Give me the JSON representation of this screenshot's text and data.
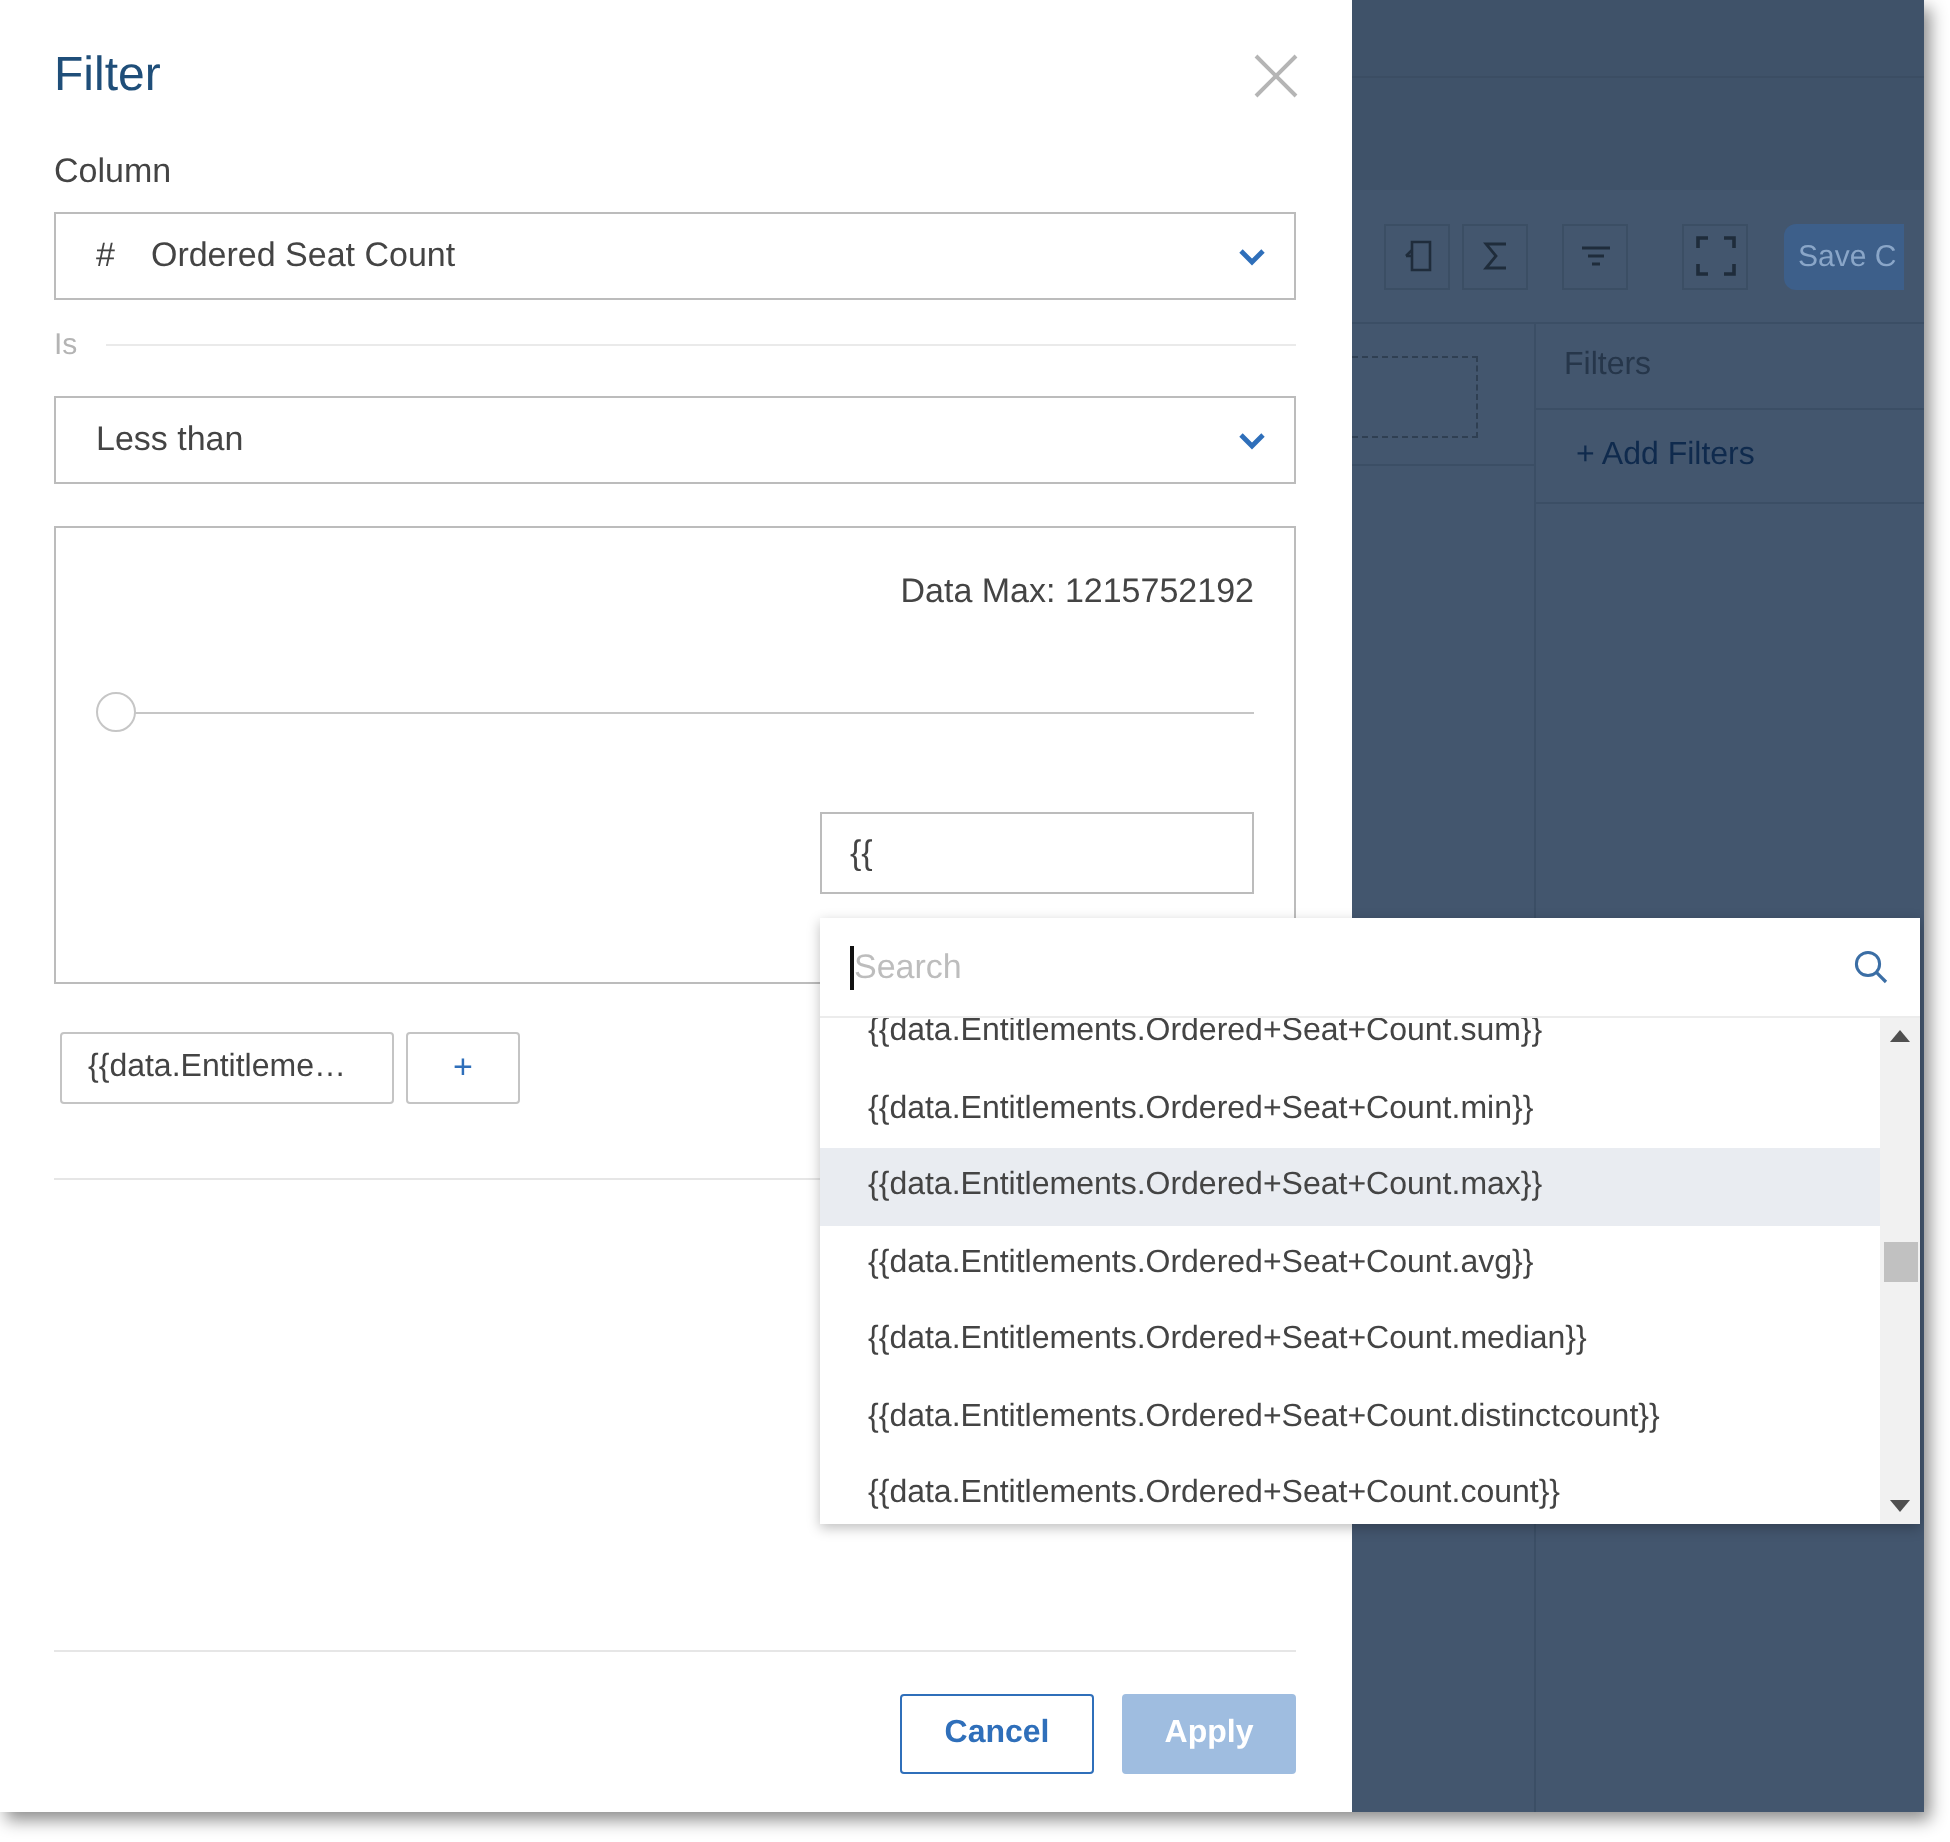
{
  "dialog": {
    "title": "Filter",
    "column_label": "Column",
    "column_select": {
      "type_icon": "#",
      "value": "Ordered Seat Count"
    },
    "is_label": "Is",
    "operator_select": {
      "value": "Less than"
    },
    "value_panel": {
      "data_max": "Data Max: 1215752192",
      "slider": {
        "level": 0
      },
      "value_input": "{{"
    },
    "chips": [
      "{{data.Entitleme…"
    ],
    "add_button": "+",
    "buttons": [
      {
        "label": "Cancel",
        "disabled": false
      },
      {
        "label": "Apply",
        "disabled": true
      }
    ]
  },
  "suggestions": {
    "placeholder": "Search",
    "items": [
      {
        "label": "{{data.Entitlements.Ordered+Seat+Count.sum}}",
        "highlighted": false
      },
      {
        "label": "{{data.Entitlements.Ordered+Seat+Count.min}}",
        "highlighted": false
      },
      {
        "label": "{{data.Entitlements.Ordered+Seat+Count.max}}",
        "highlighted": true
      },
      {
        "label": "{{data.Entitlements.Ordered+Seat+Count.avg}}",
        "highlighted": false
      },
      {
        "label": "{{data.Entitlements.Ordered+Seat+Count.median}}",
        "highlighted": false
      },
      {
        "label": "{{data.Entitlements.Ordered+Seat+Count.distinctcount}}",
        "highlighted": false
      },
      {
        "label": "{{data.Entitlements.Ordered+Seat+Count.count}}",
        "highlighted": false
      }
    ]
  },
  "background": {
    "save_button": "Save C",
    "filters_title": "Filters",
    "add_filters": "+ Add Filters"
  }
}
